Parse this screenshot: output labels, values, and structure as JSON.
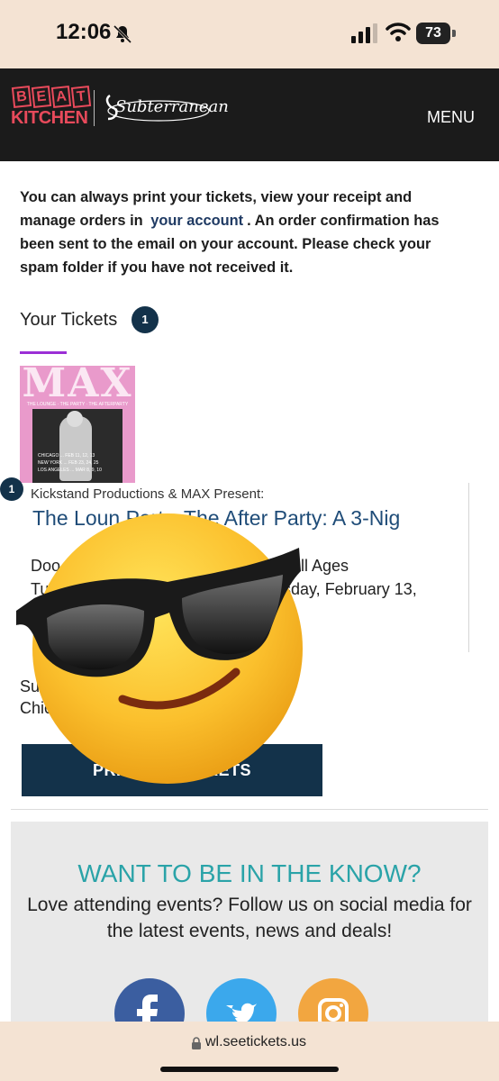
{
  "status_bar": {
    "time": "12:06",
    "battery": "73",
    "icons": [
      "bell-slash-icon",
      "signal-icon",
      "wifi-icon",
      "battery-icon"
    ]
  },
  "header": {
    "logo_beat_letters": [
      "B",
      "E",
      "A",
      "T"
    ],
    "logo_kitchen": "KITCHEN",
    "logo_subterranean": "Subterranean",
    "menu_label": "MENU"
  },
  "confirmation": {
    "text_before": "You can always print your tickets, view your receipt and manage orders in",
    "link": "your account",
    "text_after": ". An order confirmation has been sent to the email on your account. Please check your spam folder if you have not received it."
  },
  "tickets": {
    "title": "Your Tickets",
    "count": "1",
    "poster": {
      "title": "MAX",
      "subtitle": "THE LOUNGE · THE PARTY · THE AFTERPARTY",
      "dates": [
        "CHICAGO ... FEB 11, 12, 13",
        "NEW YORK ... FEB 23, 24, 25",
        "LOS ANGELES ... MAR 8, 9, 10"
      ]
    },
    "item": {
      "index": "1",
      "presenter": "Kickstand Productions & MAX Present:",
      "title": "The Loun Party, The After Party: A 3-Nig",
      "meta_line1_a": "Doo",
      "meta_line1_b": "All Ages",
      "meta_line2_a": "Tu",
      "meta_line2_b": "sday, February 13,",
      "venue_line1": "Su",
      "venue_line2": "Chic"
    },
    "print_button": "PRINT/DO TICKETS"
  },
  "newsletter": {
    "title": "WANT TO BE IN THE KNOW?",
    "body": "Love attending events? Follow us on social media for the latest events, news and deals!",
    "social": [
      "facebook-icon",
      "twitter-icon",
      "instagram-icon"
    ]
  },
  "browser": {
    "url": "wl.seetickets.us"
  },
  "colors": {
    "navy": "#13324a",
    "accent_purple": "#9b2fd6",
    "teal": "#2aa3a8",
    "link_blue": "#1f4c78"
  }
}
